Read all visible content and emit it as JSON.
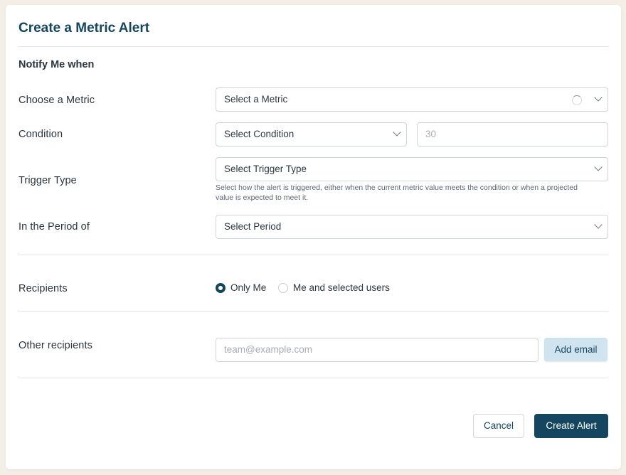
{
  "dialog": {
    "title": "Create a Metric Alert",
    "section_heading": "Notify Me when"
  },
  "fields": {
    "metric": {
      "label": "Choose a Metric",
      "value": "Select a Metric"
    },
    "condition": {
      "label": "Condition",
      "value": "Select Condition",
      "threshold_placeholder": "30"
    },
    "trigger_type": {
      "label": "Trigger Type",
      "value": "Select Trigger Type",
      "help": "Select how the alert is triggered, either when the current metric value meets the condition or when a projected value is expected to meet it."
    },
    "period": {
      "label": "In the Period of",
      "value": "Select Period"
    }
  },
  "recipients": {
    "label": "Recipients",
    "options": [
      {
        "label": "Only Me",
        "checked": true
      },
      {
        "label": "Me and selected users",
        "checked": false
      }
    ]
  },
  "other_recipients": {
    "label": "Other recipients",
    "placeholder": "team@example.com",
    "add_label": "Add email"
  },
  "actions": {
    "cancel_label": "Cancel",
    "create_label": "Create Alert"
  },
  "colors": {
    "accent": "#15465f",
    "page_background": "#f3efe6",
    "add_button_background": "#cfe4ef"
  }
}
